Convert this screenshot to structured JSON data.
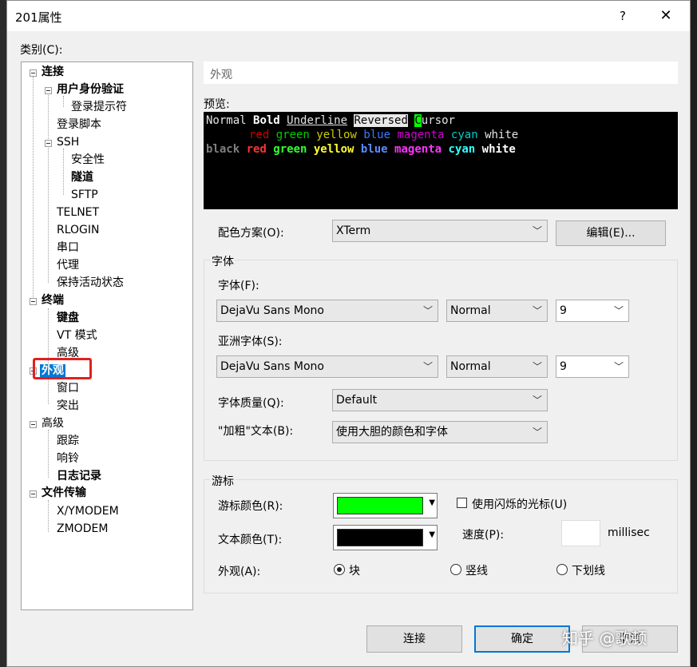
{
  "window": {
    "title": "201属性",
    "help": "?",
    "close": "✕"
  },
  "category_label": "类别(C):",
  "tree": {
    "connection": "连接",
    "auth": "用户身份验证",
    "login_prompt": "登录提示符",
    "login_script": "登录脚本",
    "ssh": "SSH",
    "security": "安全性",
    "tunnel": "隧道",
    "sftp": "SFTP",
    "telnet": "TELNET",
    "rlogin": "RLOGIN",
    "serial": "串口",
    "proxy": "代理",
    "keepalive": "保持活动状态",
    "terminal": "终端",
    "keyboard": "键盘",
    "vt_mode": "VT 模式",
    "advanced_term": "高级",
    "appearance": "外观",
    "window": "窗口",
    "highlight": "突出",
    "advanced": "高级",
    "trace": "跟踪",
    "bell": "响铃",
    "logging": "日志记录",
    "file_transfer": "文件传输",
    "xymodem": "X/YMODEM",
    "zmodem": "ZMODEM"
  },
  "section_title": "外观",
  "preview": {
    "label": "预览:",
    "l1_normal": "Normal ",
    "l1_bold": "Bold",
    "l1_underline": "Underline",
    "l1_reversed": "Reversed",
    "l1_cursor_c": "C",
    "l1_cursor_rest": "ursor",
    "l2": [
      "red",
      "green",
      "yellow",
      "blue",
      "magenta",
      "cyan",
      "white"
    ],
    "l3": [
      "black",
      "red",
      "green",
      "yellow",
      "blue",
      "magenta",
      "cyan",
      "white"
    ],
    "colors": {
      "black": "#555555",
      "red": "#cd0000",
      "green": "#00cd00",
      "yellow": "#cdcd00",
      "blue": "#3b78ff",
      "magenta": "#cd00cd",
      "cyan": "#00cdcd",
      "white": "#e5e5e5",
      "bblack": "#7f7f7f",
      "bred": "#ff3333",
      "bgreen": "#33ff33",
      "byellow": "#ffff33",
      "bblue": "#5c8cff",
      "bmagenta": "#ff33ff",
      "bcyan": "#33ffff",
      "bwhite": "#ffffff"
    }
  },
  "scheme": {
    "label": "配色方案(O):",
    "value": "XTerm",
    "edit_btn": "编辑(E)..."
  },
  "font_group": {
    "title": "字体",
    "font_label": "字体(F):",
    "font_value": "DejaVu Sans Mono",
    "style_value": "Normal",
    "size_value": "9",
    "asian_label": "亚洲字体(S):",
    "asian_value": "DejaVu Sans Mono",
    "asian_style": "Normal",
    "asian_size": "9",
    "quality_label": "字体质量(Q):",
    "quality_value": "Default",
    "bold_label": "\"加粗\"文本(B):",
    "bold_value": "使用大胆的颜色和字体"
  },
  "cursor_group": {
    "title": "游标",
    "cursor_color_label": "游标颜色(R):",
    "cursor_color": "#00ff00",
    "blink_label": "使用闪烁的光标(U)",
    "text_color_label": "文本颜色(T):",
    "text_color": "#000000",
    "speed_label": "速度(P):",
    "speed_unit": "millisec",
    "shape_label": "外观(A):",
    "shape_block": "块",
    "shape_vertical": "竖线",
    "shape_underline": "下划线"
  },
  "buttons": {
    "connect": "连接",
    "ok": "确定",
    "cancel": "取消"
  },
  "watermark": "知乎 @歌顿"
}
